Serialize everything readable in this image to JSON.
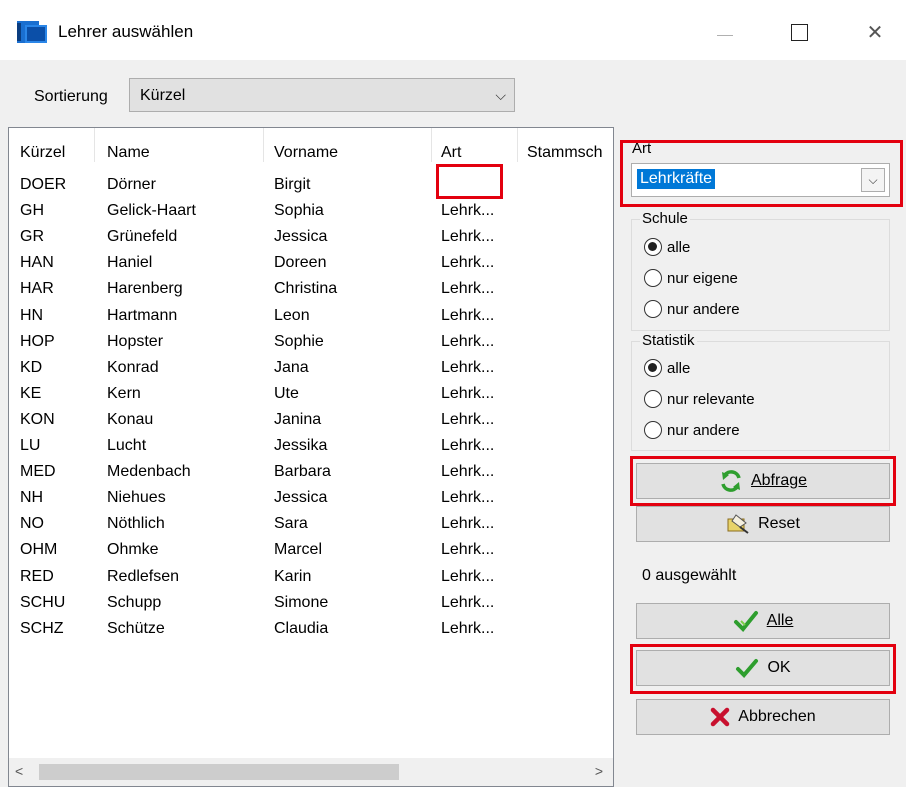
{
  "window": {
    "title": "Lehrer auswählen",
    "icon": "app-icon",
    "controls": [
      "minimize-icon",
      "maximize-icon",
      "close-icon"
    ],
    "close_glyph": "✕"
  },
  "sort": {
    "label": "Sortierung",
    "value": "Kürzel"
  },
  "table": {
    "headers": [
      "Kürzel",
      "Name",
      "Vorname",
      "Art",
      "Stammsch"
    ],
    "rows": [
      [
        "DOER",
        "Dörner",
        "Birgit",
        ""
      ],
      [
        "GH",
        "Gelick-Haart",
        "Sophia",
        "Lehrk..."
      ],
      [
        "GR",
        "Grünefeld",
        "Jessica",
        "Lehrk..."
      ],
      [
        "HAN",
        "Haniel",
        "Doreen",
        "Lehrk..."
      ],
      [
        "HAR",
        "Harenberg",
        "Christina",
        "Lehrk..."
      ],
      [
        "HN",
        "Hartmann",
        "Leon",
        "Lehrk..."
      ],
      [
        "HOP",
        "Hopster",
        "Sophie",
        "Lehrk..."
      ],
      [
        "KD",
        "Konrad",
        "Jana",
        "Lehrk..."
      ],
      [
        "KE",
        "Kern",
        "Ute",
        "Lehrk..."
      ],
      [
        "KON",
        "Konau",
        "Janina",
        "Lehrk..."
      ],
      [
        "LU",
        "Lucht",
        "Jessika",
        "Lehrk..."
      ],
      [
        "MED",
        "Medenbach",
        "Barbara",
        "Lehrk..."
      ],
      [
        "NH",
        "Niehues",
        "Jessica",
        "Lehrk..."
      ],
      [
        "NO",
        "Nöthlich",
        "Sara",
        "Lehrk..."
      ],
      [
        "OHM",
        "Ohmke",
        "Marcel",
        "Lehrk..."
      ],
      [
        "RED",
        "Redlefsen",
        "Karin",
        "Lehrk..."
      ],
      [
        "SCHU",
        "Schupp",
        "Simone",
        "Lehrk..."
      ],
      [
        "SCHZ",
        "Schütze",
        "Claudia",
        "Lehrk..."
      ]
    ]
  },
  "filter": {
    "art_label": "Art",
    "art_value": "Lehrkräfte",
    "schule": {
      "title": "Schule",
      "options": [
        "alle",
        "nur eigene",
        "nur andere"
      ],
      "selected": "alle"
    },
    "statistik": {
      "title": "Statistik",
      "options": [
        "alle",
        "nur relevante",
        "nur andere"
      ],
      "selected": "alle"
    }
  },
  "buttons": {
    "abfrage": "Abfrage",
    "reset": "Reset",
    "alle": "Alle",
    "ok": "OK",
    "abbrechen": "Abbrechen"
  },
  "status": "0 ausgewählt",
  "colors": {
    "highlight_box": "#e3000f",
    "selection": "#0078d7",
    "check_green": "#2e9e2e",
    "cancel_red": "#c8102e"
  }
}
